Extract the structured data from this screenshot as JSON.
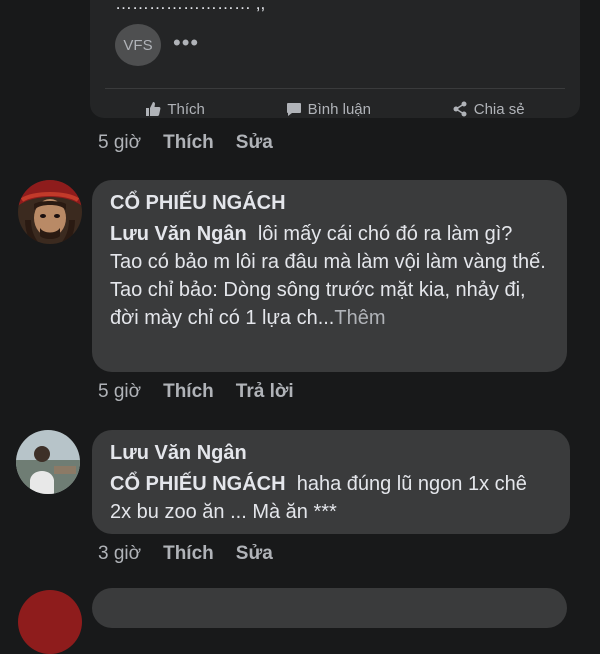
{
  "shared_post": {
    "partial_text": "…………………… ,,",
    "page_avatar": "VFS",
    "actions": {
      "like": "Thích",
      "comment": "Bình luận",
      "share": "Chia sẻ"
    },
    "meta": {
      "time": "5 giờ",
      "like": "Thích",
      "edit": "Sửa"
    }
  },
  "comments": [
    {
      "author": "CỔ PHIẾU NGÁCH",
      "mention": "Lưu Văn Ngân",
      "text": "lôi mấy cái chó đó ra làm gì? Tao có bảo m lôi ra đâu mà làm vội làm vàng thế. Tao chỉ bảo: Dòng sông trước mặt kia, nhảy đi, đời mày chỉ có 1 lựa ch...",
      "see_more": "Thêm",
      "time": "5 giờ",
      "like": "Thích",
      "reply": "Trả lời"
    },
    {
      "author": "Lưu Văn Ngân",
      "mention": "CỔ PHIẾU NGÁCH",
      "text": "haha đúng lũ ngon 1x chê 2x bu zoo ăn ... Mà ăn ***",
      "time": "3 giờ",
      "like": "Thích",
      "edit": "Sửa"
    }
  ],
  "colors": {
    "background": "#18191a",
    "bubble": "#3a3b3c",
    "text": "#e4e6eb",
    "secondary": "#b0b3b8"
  }
}
